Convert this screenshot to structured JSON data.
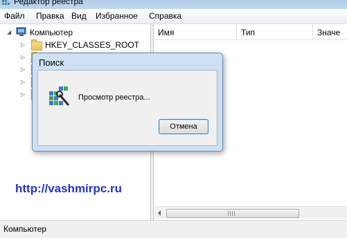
{
  "window": {
    "title": "Редактор реестра"
  },
  "menu": {
    "items": [
      "Файл",
      "Правка",
      "Вид",
      "Избранное",
      "Справка"
    ]
  },
  "tree": {
    "root_label": "Компьютер",
    "first_key_label": "HKEY_CLASSES_ROOT"
  },
  "list": {
    "columns": [
      "Имя",
      "Тип",
      "Значе"
    ]
  },
  "dialog": {
    "title": "Поиск",
    "message": "Просмотр реестра...",
    "cancel_label": "Отмена"
  },
  "status": {
    "path": "Компьютер"
  },
  "watermark": {
    "text": "http://vashmirpc.ru"
  },
  "colors": {
    "watermark": "#2233cc",
    "dialog_frame": "#cfe0f2",
    "titlebar": "#aecbe6"
  },
  "icons": {
    "app": "registry-editor-icon",
    "computer": "computer-icon",
    "folder": "folder-icon",
    "dialog": "registry-search-icon"
  }
}
